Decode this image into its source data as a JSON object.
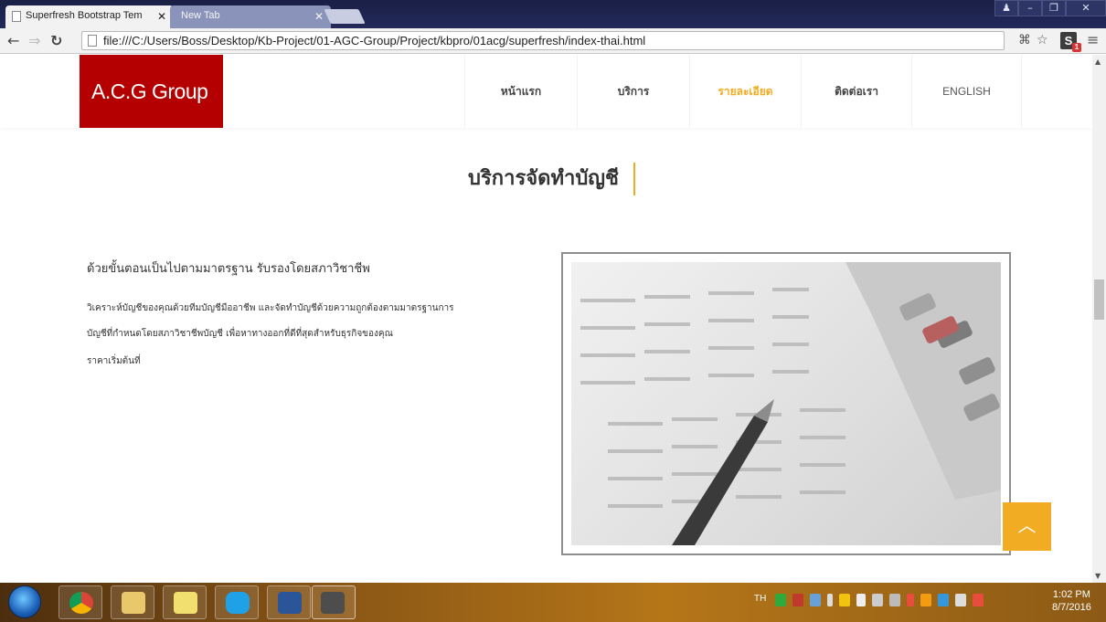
{
  "browser": {
    "tabs": [
      {
        "label": "Superfresh Bootstrap Tem",
        "active": true
      },
      {
        "label": "New Tab",
        "active": false
      }
    ],
    "url": "file:///C:/Users/Boss/Desktop/Kb-Project/01-AGC-Group/Project/kbpro/01acg/superfresh/index-thai.html",
    "extension_badge": "S",
    "extension_count": "1"
  },
  "site": {
    "logo": "A.C.G Group",
    "nav": [
      {
        "label": "หน้าแรก",
        "active": false
      },
      {
        "label": "บริการ",
        "active": false
      },
      {
        "label": "รายละเอียด",
        "active": true
      },
      {
        "label": "ติดต่อเรา",
        "active": false
      },
      {
        "label": "ENGLISH",
        "active": false
      }
    ],
    "accent_color": "#f2ac23",
    "logo_color": "#b40000"
  },
  "content": {
    "section_title": "บริการจัดทำบัญชี",
    "subtitle": "ด้วยขั้นตอนเป็นไปตามมาตรฐาน รับรองโดยสภาวิชาชีพ",
    "paragraph_line1": "วิเคราะห์บัญชีของคุณด้วยทีมบัญชีมืออาชีพ และจัดทำบัญชีด้วยความถูกต้องตามมาตรฐานการ",
    "paragraph_line2": "บัญชีที่กำหนดโดยสภาวิชาชีพบัญชี เพื่อหาทางออกที่ดีที่สุดสำหรับธุรกิจของคุณ",
    "price_text": "ราคาเริ่มต้นที่",
    "back_to_top": "^"
  },
  "taskbar": {
    "language": "TH",
    "time": "1:02 PM",
    "date": "8/7/2016"
  }
}
